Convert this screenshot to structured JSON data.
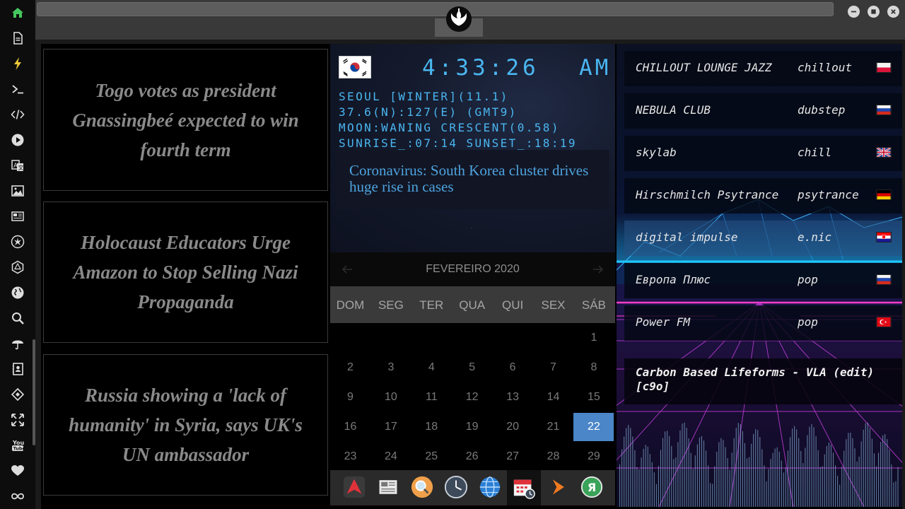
{
  "sidebar": {
    "items": [
      {
        "name": "home-icon",
        "color": "#45c75f"
      },
      {
        "name": "document-icon"
      },
      {
        "name": "lightning-icon",
        "color": "#f0c93a"
      },
      {
        "name": "terminal-icon"
      },
      {
        "name": "code-icon"
      },
      {
        "name": "play-icon"
      },
      {
        "name": "translate-icon"
      },
      {
        "name": "image-icon"
      },
      {
        "name": "newspaper-icon"
      },
      {
        "name": "rebel-alliance-icon"
      },
      {
        "name": "empire-icon"
      },
      {
        "name": "globe-icon"
      },
      {
        "name": "search-icon"
      },
      {
        "name": "umbrella-icon"
      },
      {
        "name": "contacts-icon"
      },
      {
        "name": "diamond-link-icon"
      },
      {
        "name": "fullscreen-icon"
      },
      {
        "name": "youtube-icon"
      },
      {
        "name": "heart-icon"
      },
      {
        "name": "infinity-icon"
      }
    ]
  },
  "topbar": {
    "emblem": "rebel-alliance-icon",
    "window_controls": [
      "minimize-icon",
      "maximize-icon",
      "close-icon"
    ]
  },
  "news": {
    "items": [
      {
        "title": "Togo votes as president Gnassingbeé expected to win fourth term"
      },
      {
        "title": "Holocaust Educators Urge Amazon to Stop Selling Nazi Propaganda"
      },
      {
        "title": "Russia showing a 'lack of humanity' in Syria, says UK's UN ambassador"
      }
    ]
  },
  "clock": {
    "time": "4:33:26",
    "ampm": "AM",
    "lines": [
      "SEOUL [WINTER](11.1)",
      "37.6(N):127(E) (GMT9)",
      "MOON:WANING CRESCENT(0.58)",
      "SUNRISE_:07:14 SUNSET_:18:19"
    ],
    "headline": "Coronavirus: South Korea cluster drives huge rise in cases",
    "flag": "south-korea-flag"
  },
  "calendar": {
    "title": "FEVEREIRO 2020",
    "weekdays": [
      "DOM",
      "SEG",
      "TER",
      "QUA",
      "QUI",
      "SEX",
      "SÁB"
    ],
    "first_weekday_index": 6,
    "days": [
      "1",
      "2",
      "3",
      "4",
      "5",
      "6",
      "7",
      "8",
      "9",
      "10",
      "11",
      "12",
      "13",
      "14",
      "15",
      "16",
      "17",
      "18",
      "19",
      "20",
      "21",
      "22",
      "23",
      "24",
      "25",
      "26",
      "27",
      "28",
      "29"
    ],
    "today": "22",
    "today_color": "#4a86c8"
  },
  "dock": {
    "items": [
      {
        "name": "app-launcher-icon"
      },
      {
        "name": "news-reader-icon"
      },
      {
        "name": "magnifier-icon"
      },
      {
        "name": "clock-icon"
      },
      {
        "name": "browser-globe-icon"
      },
      {
        "name": "calendar-app-icon",
        "active": true
      },
      {
        "name": "media-player-icon"
      },
      {
        "name": "yandex-icon"
      }
    ]
  },
  "radio": {
    "stations": [
      {
        "name": "CHILLOUT LOUNGE JAZZ",
        "genre": "chillout",
        "flag": "poland-flag"
      },
      {
        "name": "NEBULA CLUB",
        "genre": "dubstep",
        "flag": "russia-flag"
      },
      {
        "name": "skylab",
        "genre": "chill",
        "flag": "uk-flag"
      },
      {
        "name": "Hirschmilch Psytrance",
        "genre": "psytrance",
        "flag": "germany-flag"
      },
      {
        "name": "digital impulse",
        "genre": "e.nic",
        "flag": "croatia-flag",
        "highlighted": true
      },
      {
        "name": "Европа Плюс",
        "genre": "pop",
        "flag": "russia-flag"
      },
      {
        "name": "Power FM",
        "genre": "pop",
        "flag": "turkey-flag"
      }
    ],
    "now_playing": "Carbon Based Lifeforms - VLA (edit) [c9o]"
  },
  "colors": {
    "accent_blue": "#4ab6f0",
    "neon_pink": "#ff3cc8",
    "neon_cyan": "#1ec8ff"
  }
}
